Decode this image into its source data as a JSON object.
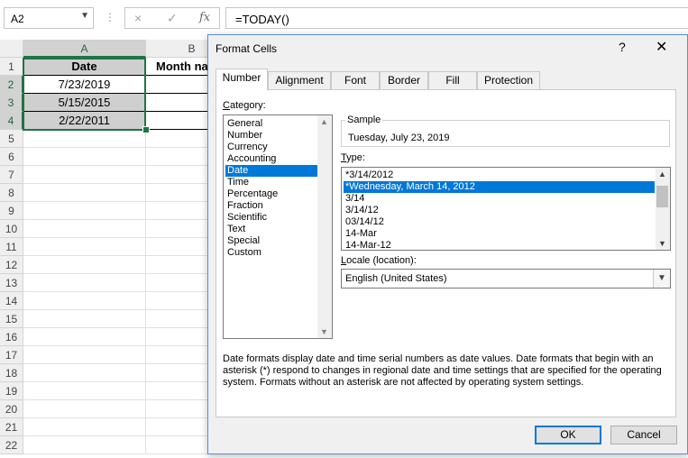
{
  "formula_bar": {
    "name_box": "A2",
    "dots": "⋮",
    "cancel_icon": "×",
    "enter_icon": "✓",
    "fx_label": "fx",
    "formula": "=TODAY()"
  },
  "sheet": {
    "columns": [
      "A",
      "B"
    ],
    "rows": [
      "1",
      "2",
      "3",
      "4",
      "5",
      "6",
      "7",
      "8",
      "9",
      "10",
      "11",
      "12",
      "13",
      "14",
      "15",
      "16",
      "17",
      "18",
      "19",
      "20",
      "21",
      "22"
    ],
    "A1": "Date",
    "B1": "Month na",
    "dates": [
      "7/23/2019",
      "5/15/2015",
      "2/22/2011"
    ]
  },
  "dialog": {
    "title": "Format Cells",
    "help": "?",
    "close": "✕",
    "tabs": [
      "Number",
      "Alignment",
      "Font",
      "Border",
      "Fill",
      "Protection"
    ],
    "category_label": "Category:",
    "category_label_key": "C",
    "category_label_rest": "ategory:",
    "categories": [
      "General",
      "Number",
      "Currency",
      "Accounting",
      "Date",
      "Time",
      "Percentage",
      "Fraction",
      "Scientific",
      "Text",
      "Special",
      "Custom"
    ],
    "selected_category": "Date",
    "sample_label": "Sample",
    "sample_value": "Tuesday, July 23, 2019",
    "type_label_key": "T",
    "type_label_rest": "ype:",
    "types": [
      "*3/14/2012",
      "*Wednesday, March 14, 2012",
      "3/14",
      "3/14/12",
      "03/14/12",
      "14-Mar",
      "14-Mar-12"
    ],
    "selected_type": "*Wednesday, March 14, 2012",
    "locale_label_key": "L",
    "locale_label_rest": "ocale (location):",
    "locale_value": "English (United States)",
    "description": "Date formats display date and time serial numbers as date values.  Date formats that begin with an asterisk (*) respond to changes in regional date and time settings that are specified for the operating system. Formats without an asterisk are not affected by operating system settings.",
    "ok_label": "OK",
    "cancel_label": "Cancel"
  }
}
